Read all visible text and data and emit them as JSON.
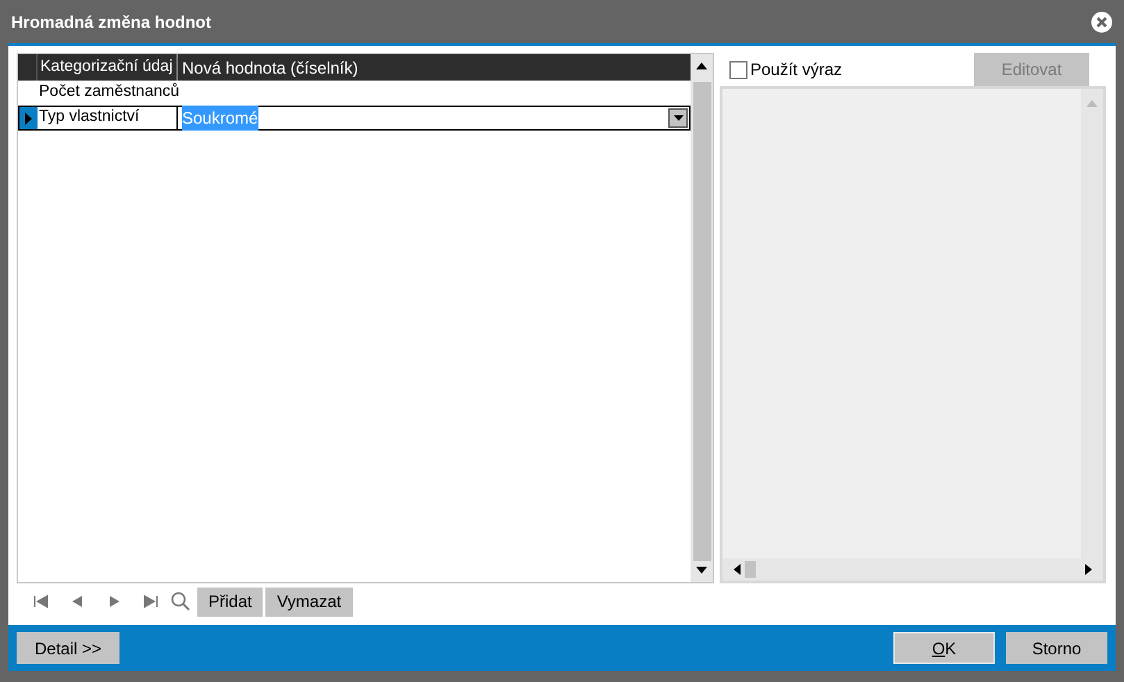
{
  "window": {
    "title": "Hromadná změna hodnot"
  },
  "table": {
    "columns": [
      "Kategorizační údaj",
      "Nová hodnota (číselník)"
    ],
    "rows": [
      {
        "label": "Počet zaměstnanců",
        "value": "",
        "selected": false
      },
      {
        "label": "Typ vlastnictví",
        "value": "Soukromé",
        "selected": true
      }
    ]
  },
  "navigator": {
    "buttons": [
      "Přidat",
      "Vymazat"
    ]
  },
  "expression": {
    "label": "Použít výraz",
    "checked": false,
    "edit_button": {
      "label": "Editovat",
      "disabled": true
    }
  },
  "footer": {
    "detail": "Detail >>",
    "ok": "OK",
    "cancel": "Storno"
  }
}
